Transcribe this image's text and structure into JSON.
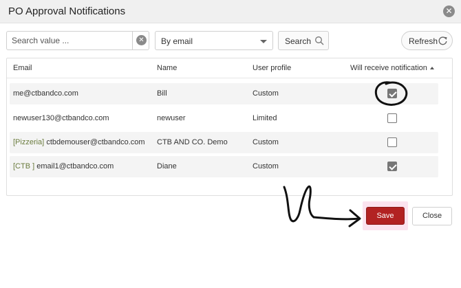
{
  "dialog": {
    "title": "PO Approval Notifications"
  },
  "toolbar": {
    "search_placeholder": "Search value ...",
    "filter_selected": "By email",
    "search_label": "Search",
    "refresh_label": "Refresh"
  },
  "table": {
    "columns": [
      "Email",
      "User profile",
      "Will receive notification"
    ],
    "name_column": "Name",
    "rows": [
      {
        "tag": "",
        "email": "me@ctbandco.com",
        "name": "Bill",
        "profile": "Custom",
        "notify": true
      },
      {
        "tag": "",
        "email": "newuser130@ctbandco.com",
        "name": "newuser",
        "profile": "Limited",
        "notify": false
      },
      {
        "tag": "[Pizzeria]",
        "email": "ctbdemouser@ctbandco.com",
        "name": "CTB AND CO. Demo",
        "profile": "Custom",
        "notify": false
      },
      {
        "tag": "[CTB ]",
        "email": "email1@ctbandco.com",
        "name": "Diane",
        "profile": "Custom",
        "notify": true
      }
    ]
  },
  "footer": {
    "save_label": "Save",
    "close_label": "Close"
  },
  "colors": {
    "save": "#b22222",
    "tag": "#6a7b3d",
    "halo": "#fbe3ef"
  }
}
